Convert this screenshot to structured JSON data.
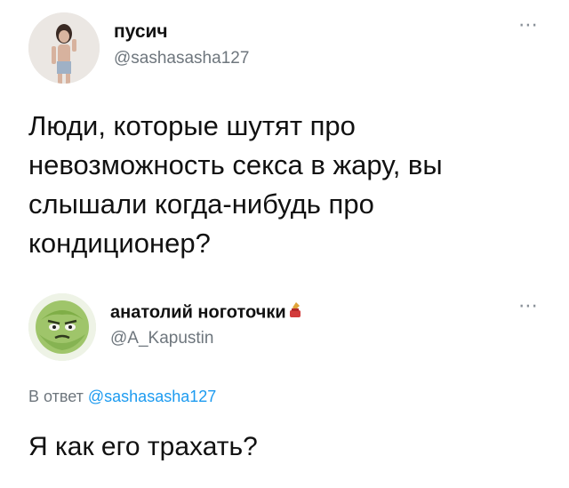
{
  "tweet": {
    "author": {
      "name": "пусич",
      "handle": "@sashasasha127"
    },
    "text": "Люди, которые шутят про невозможность секса в жару, вы слышали когда-нибудь про кондиционер?",
    "more_icon": "⋯"
  },
  "reply": {
    "author": {
      "name": "анатолий ноготочки",
      "handle": "@A_Kapustin",
      "name_emoji": "nail-polish-icon"
    },
    "in_reply_to_prefix": "В ответ ",
    "in_reply_to_handle": "@sashasasha127",
    "text": "Я как его трахать?",
    "more_icon": "⋯"
  },
  "colors": {
    "text": "#111111",
    "secondary": "#6e767d",
    "link": "#1d9bf0"
  }
}
